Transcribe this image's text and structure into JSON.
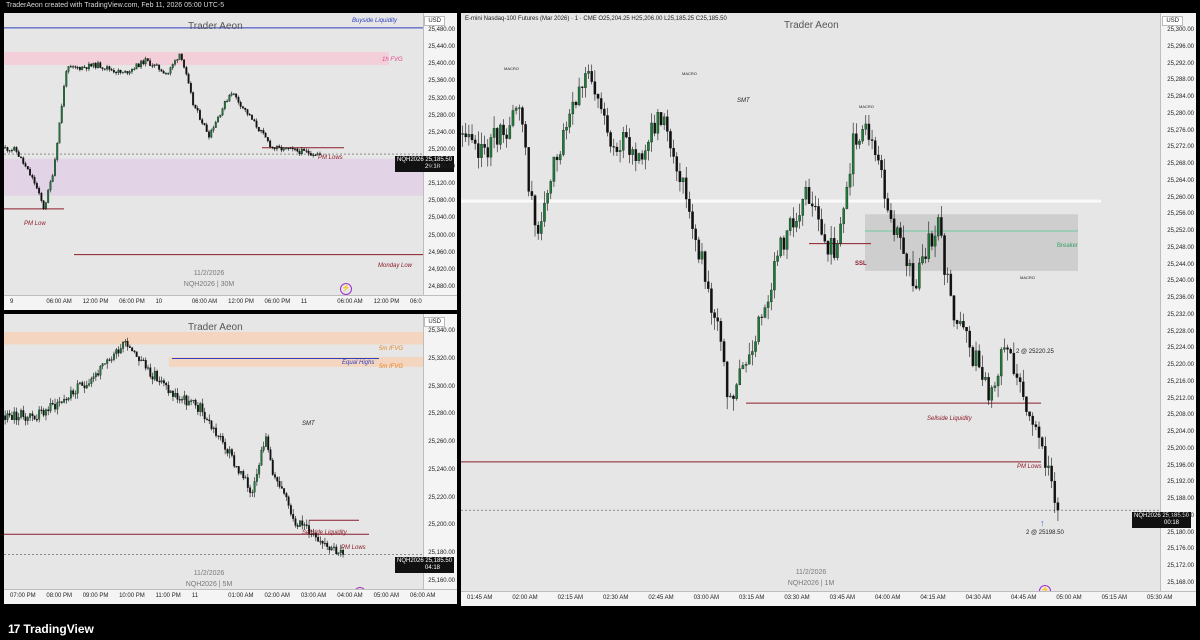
{
  "header": {
    "created_by": "TraderAeon created with TradingView.com, Feb 11, 2026 05:00 UTC-5"
  },
  "footer": {
    "brand": "TradingView",
    "logo_glyph": "17"
  },
  "colors": {
    "up": "#1f7a3a",
    "down": "#111111",
    "pdl": "#8b1c2b",
    "blue": "#2e3fbf",
    "fvg": "#e64a8a",
    "orange": "#e8811f"
  },
  "panels": [
    {
      "id": "p1",
      "title": "Trader Aeon",
      "currency": "USD",
      "watermark_date": "11/2/2026",
      "watermark_symbol": "NQH2026 | 30M",
      "price_tag": {
        "symbol": "NQH2026",
        "price": "25,185.50",
        "timer": "29:18"
      },
      "y_ticks": [
        "25,480.00",
        "25,440.00",
        "25,400.00",
        "25,360.00",
        "25,320.00",
        "25,280.00",
        "25,240.00",
        "25,200.00",
        "25,160.00",
        "25,120.00",
        "25,080.00",
        "25,040.00",
        "25,000.00",
        "24,960.00",
        "24,920.00",
        "24,880.00"
      ],
      "x_ticks": [
        "9",
        "06:00 AM",
        "12:00 PM",
        "06:00 PM",
        "10",
        "06:00 AM",
        "12:00 PM",
        "06:00 PM",
        "11",
        "06:00 AM",
        "12:00 PM",
        "06:0"
      ],
      "labels": {
        "buyside": "Buyside Liquidity",
        "fvg": "1h FVG",
        "pm_lows": "PM Lows",
        "pm_low": "PM Low",
        "monday_low": "Monday Low"
      },
      "chart_data": {
        "type": "candlestick",
        "ylim": [
          24860,
          25500
        ],
        "levels": {
          "buyside_liquidity": 25475,
          "pm_lows": 25200,
          "pm_low": 25060,
          "monday_low": 24955,
          "last": 25185.5
        }
      }
    },
    {
      "id": "p2",
      "title": "Trader Aeon",
      "currency": "USD",
      "watermark_date": "11/2/2026",
      "watermark_symbol": "NQH2026 | 5M",
      "price_tag": {
        "symbol": "NQH2026",
        "price": "25,185.50",
        "timer": "04:18"
      },
      "y_ticks": [
        "25,340.00",
        "25,320.00",
        "25,300.00",
        "25,280.00",
        "25,260.00",
        "25,240.00",
        "25,220.00",
        "25,200.00",
        "25,180.00",
        "25,160.00"
      ],
      "x_ticks": [
        "07:00 PM",
        "08:00 PM",
        "09:00 PM",
        "10:00 PM",
        "11:00 PM",
        "11",
        "01:00 AM",
        "02:00 AM",
        "03:00 AM",
        "04:00 AM",
        "05:00 AM",
        "06:00 AM"
      ],
      "labels": {
        "fvg1": "5m IFVG",
        "equal_highs": "Equal Highs",
        "fvg2": "5m IFVG",
        "smt": "SMT",
        "sellside": "Sellside Liquidity",
        "pm_lows": "PM Lows"
      },
      "chart_data": {
        "type": "candlestick",
        "ylim": [
          25160,
          25355
        ],
        "levels": {
          "equal_highs": 25326,
          "sellside_liquidity": 25210,
          "pm_lows": 25200,
          "last": 25185.5
        }
      }
    },
    {
      "id": "p3",
      "title": "Trader Aeon",
      "currency": "USD",
      "symbol_line": "E-mini Nasdaq-100 Futures (Mar 2026) · 1 · CME  O25,204.25  H25,206.00  L25,185.25  C25,185.50",
      "watermark_date": "11/2/2026",
      "watermark_symbol": "NQH2026 | 1M",
      "price_tag": {
        "symbol": "NQH2026",
        "price": "25,185.50",
        "timer": "00:18"
      },
      "y_ticks": [
        "25,300.00",
        "25,296.00",
        "25,292.00",
        "25,288.00",
        "25,284.00",
        "25,280.00",
        "25,276.00",
        "25,272.00",
        "25,268.00",
        "25,264.00",
        "25,260.00",
        "25,256.00",
        "25,252.00",
        "25,248.00",
        "25,244.00",
        "25,240.00",
        "25,236.00",
        "25,232.00",
        "25,228.00",
        "25,224.00",
        "25,220.00",
        "25,216.00",
        "25,212.00",
        "25,208.00",
        "25,204.00",
        "25,200.00",
        "25,196.00",
        "25,192.00",
        "25,188.00",
        "25,184.00",
        "25,180.00",
        "25,176.00",
        "25,172.00",
        "25,168.00"
      ],
      "x_ticks": [
        "01:45 AM",
        "02:00 AM",
        "02:15 AM",
        "02:30 AM",
        "02:45 AM",
        "03:00 AM",
        "03:15 AM",
        "03:30 AM",
        "03:45 AM",
        "04:00 AM",
        "04:15 AM",
        "04:30 AM",
        "04:45 AM",
        "05:00 AM",
        "05:15 AM",
        "05:30 AM"
      ],
      "labels": {
        "macro": "MACRO",
        "smt": "SMT",
        "ssl": "SSL",
        "breaker": "Breaker",
        "sellside": "Sellside Liquidity",
        "pm_lows": "PM Lows",
        "order1": "2 @ 25220.25",
        "order2": "2 @ 25198.50"
      },
      "chart_data": {
        "type": "candlestick",
        "ylim": [
          25166,
          25303
        ],
        "levels": {
          "sellside_liquidity": 25211,
          "pm_lows": 25197,
          "ssl": 25249,
          "breaker": 25252,
          "last": 25185.5
        }
      }
    }
  ]
}
